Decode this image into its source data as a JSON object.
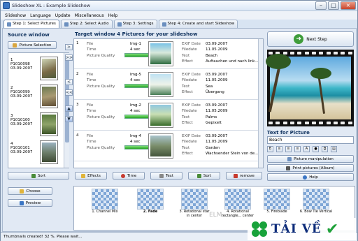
{
  "window": {
    "title": "Slideshow XL : Example Slideshow"
  },
  "menu": [
    "Slideshow",
    "Language",
    "Update",
    "Miscellaneous",
    "Help"
  ],
  "tabs": [
    "Step 1: Select Pictures",
    "Step 2: Select Audio",
    "Step 3: Settings",
    "Step 4: Create and start Slideshow"
  ],
  "source": {
    "header": "Source window",
    "picture_selection": "Picture Selection",
    "items": [
      {
        "num": "1",
        "name": "P1010098",
        "date": "03.09.2007"
      },
      {
        "num": "2",
        "name": "P1010099",
        "date": "03.09.2007"
      },
      {
        "num": "3",
        "name": "P1010100",
        "date": "03.09.2007"
      },
      {
        "num": "4",
        "name": "P1010101",
        "date": "03.09.2007"
      }
    ],
    "sort": "Sort",
    "choose": "Choose",
    "preview": "Preview"
  },
  "target": {
    "header": "Target window 4 Pictures for your slideshow",
    "labels": {
      "file": "File",
      "time": "Time",
      "quality": "Picture Quality",
      "exif": "EXIF Date",
      "filedate": "Filedate",
      "text": "Text",
      "effect": "Effect"
    },
    "rows": [
      {
        "idx": "1",
        "file": "Img-1",
        "time": "4 sec",
        "exif": "03.09.2007",
        "filedate": "11.05.2009",
        "text": "Beach",
        "effect": "Auftauchen und nach link..."
      },
      {
        "idx": "2",
        "file": "Img-5",
        "time": "4 sec",
        "exif": "03.09.2007",
        "filedate": "11.05.2009",
        "text": "Sea",
        "effect": "Übergang"
      },
      {
        "idx": "3",
        "file": "Img-2",
        "time": "4 sec",
        "exif": "03.09.2007",
        "filedate": "11.05.2009",
        "text": "Palms",
        "effect": "Gepixelt"
      },
      {
        "idx": "4",
        "file": "Img-4",
        "time": "4 sec",
        "exif": "03.09.2007",
        "filedate": "11.05.2009",
        "text": "Garden",
        "effect": "Wachsender Stein von de..."
      }
    ],
    "buttons": {
      "effects": "Effects",
      "time": "Time",
      "text": "Text",
      "sort": "Sort",
      "remove": "remove"
    }
  },
  "preview": {
    "next_step": "Next Step",
    "text_for_picture": "Text for Picture",
    "text_value": "Beach",
    "picture_manipulation": "Picture manipulation",
    "print": "Print pictures (Album)",
    "help": "Help"
  },
  "transitions": [
    {
      "label": "1. Channel Mix"
    },
    {
      "label": "2. Fade"
    },
    {
      "label": "3. Rotational star in center"
    },
    {
      "label": "4. Rotational rectangle... center"
    },
    {
      "label": "5. Fireblade"
    },
    {
      "label": "6. Bow Tie Vertical"
    }
  ],
  "status": "Thumbnails created! 32 %. Please wait...",
  "watermark": {
    "text": "TẢI VỀ",
    "site": "ELM..."
  },
  "colors": {
    "quality_bar": "#27a323",
    "accent": "#10325e"
  }
}
